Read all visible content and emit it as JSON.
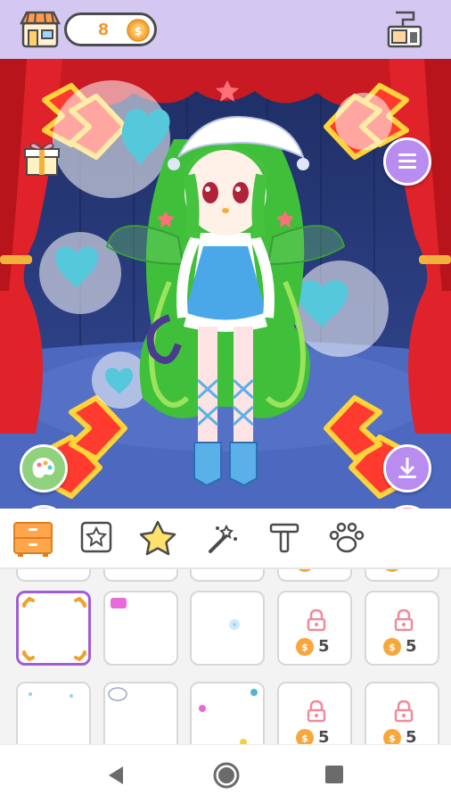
{
  "topbar": {
    "coins": "8",
    "shop_icon": "shop-icon",
    "coin_icon": "coin-icon",
    "dress_icon": "dressing-room-icon"
  },
  "stage": {
    "gift_icon": "gift-icon",
    "menu_icon": "menu-icon",
    "palette_icon": "palette-icon",
    "avatar_icon": "add-avatar-icon",
    "download_icon": "download-icon",
    "trash_icon": "trash-icon"
  },
  "tabs": [
    {
      "name": "drawer",
      "icon": "drawer-icon",
      "active": true
    },
    {
      "name": "sticker-frame",
      "icon": "star-frame-icon",
      "active": false
    },
    {
      "name": "star",
      "icon": "star-icon",
      "active": false
    },
    {
      "name": "magic",
      "icon": "magic-wand-icon",
      "active": false
    },
    {
      "name": "text",
      "icon": "text-icon",
      "active": false
    },
    {
      "name": "pet",
      "icon": "paw-icon",
      "active": false
    }
  ],
  "grid": {
    "rows": [
      [
        {
          "locked": false,
          "selected": true
        },
        {
          "locked": false
        },
        {
          "locked": false
        },
        {
          "locked": true,
          "price": "5"
        },
        {
          "locked": true,
          "price": "5"
        }
      ],
      [
        {
          "locked": false
        },
        {
          "locked": false
        },
        {
          "locked": false
        },
        {
          "locked": true,
          "price": "5"
        },
        {
          "locked": true,
          "price": "5"
        }
      ]
    ],
    "partial_row": [
      {
        "locked": false
      },
      {
        "locked": false
      },
      {
        "locked": false
      },
      {
        "locked": true,
        "price": "5"
      },
      {
        "locked": true,
        "price": "5"
      }
    ]
  },
  "colors": {
    "topbar": "#d4c8f3",
    "accent_purple": "#a35bd6",
    "coin_orange": "#f39a2f",
    "curtain_red": "#e0222a",
    "stage_blue": "#283b7a"
  },
  "nav": {
    "back_icon": "back-icon",
    "home_icon": "home-icon",
    "recent_icon": "recent-apps-icon"
  }
}
